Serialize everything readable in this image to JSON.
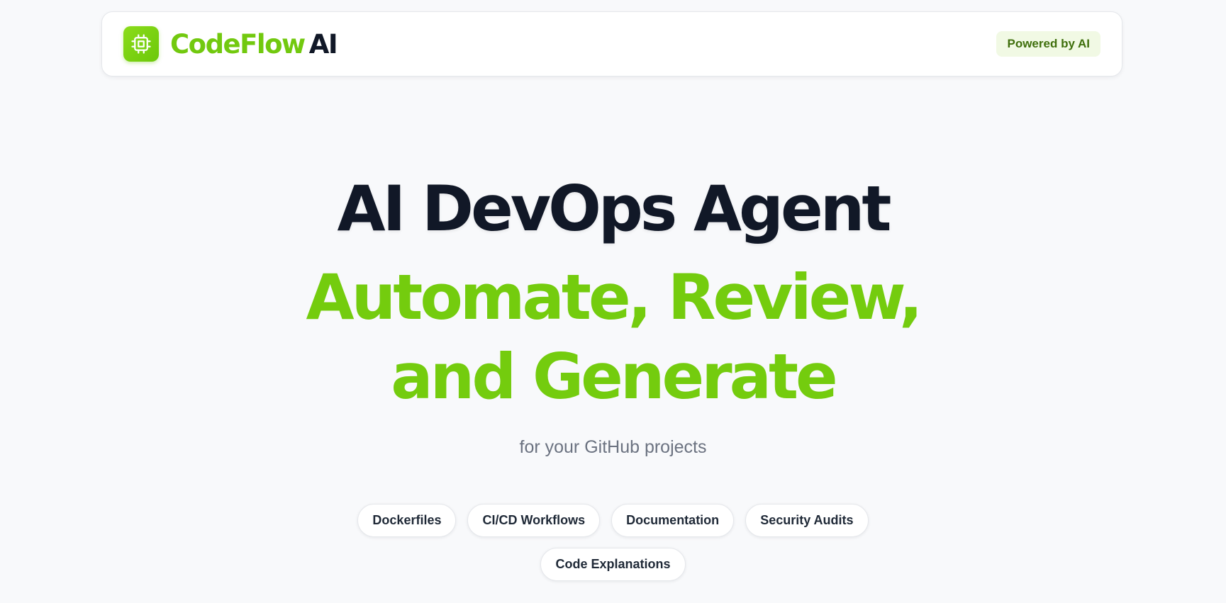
{
  "header": {
    "brand_primary": "CodeFlow",
    "brand_secondary": "AI",
    "logo_icon": "cpu-chip-icon",
    "badge": "Powered by AI"
  },
  "hero": {
    "title": "AI DevOps Agent",
    "subtitle": "Automate, Review, and Generate",
    "tagline": "for your GitHub projects"
  },
  "features": [
    "Dockerfiles",
    "CI/CD Workflows",
    "Documentation",
    "Security Audits",
    "Code Explanations"
  ],
  "colors": {
    "accent": "#74cc0e",
    "dark": "#111827",
    "muted": "#6b7280",
    "background": "#f8f9fb"
  }
}
